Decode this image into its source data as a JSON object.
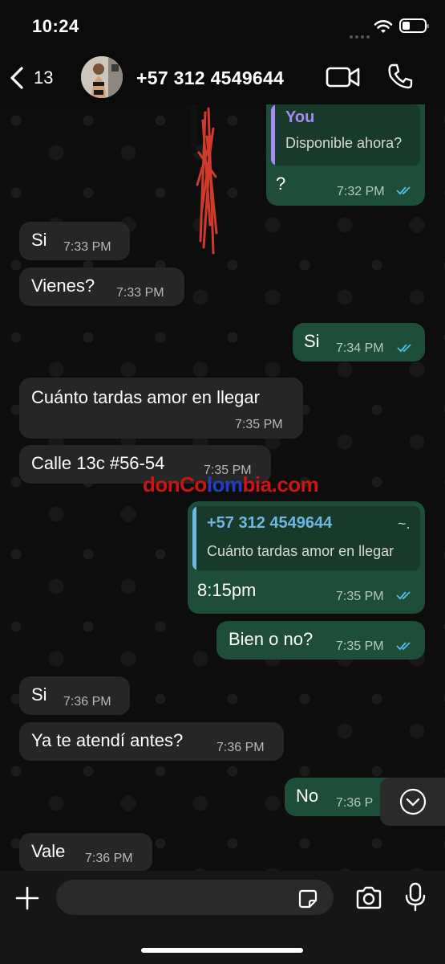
{
  "status_bar": {
    "time": "10:24"
  },
  "header": {
    "back_count": "13",
    "contact_name": "+57 312 4549644"
  },
  "messages": [
    {
      "quote_author": "You",
      "quote_text": "Disponible ahora?",
      "text": "?",
      "time": "7:32 PM",
      "direction": "out"
    },
    {
      "text": "Si",
      "time": "7:33 PM",
      "direction": "in"
    },
    {
      "text": "Vienes?",
      "time": "7:33 PM",
      "direction": "in"
    },
    {
      "text": "Si",
      "time": "7:34 PM",
      "direction": "out"
    },
    {
      "text": "Cuánto tardas amor en llegar",
      "time": "7:35 PM",
      "direction": "in"
    },
    {
      "text": "Calle 13c #56-54",
      "time": "7:35 PM",
      "direction": "in"
    },
    {
      "quote_author": "+57 312 4549644",
      "quote_tilde": "~.",
      "quote_text": "Cuánto tardas amor en llegar",
      "text": "8:15pm",
      "time": "7:35 PM",
      "direction": "out"
    },
    {
      "text": "Bien o no?",
      "time": "7:35 PM",
      "direction": "out"
    },
    {
      "text": "Si",
      "time": "7:36 PM",
      "direction": "in"
    },
    {
      "text": "Ya te atendí antes?",
      "time": "7:36 PM",
      "direction": "in"
    },
    {
      "text": "No",
      "time": "7:36 P",
      "direction": "out"
    },
    {
      "text": "Vale",
      "time": "7:36 PM",
      "direction": "in"
    }
  ],
  "watermark": {
    "part1": "donCo",
    "part2": "lom",
    "part3": "bia.com"
  },
  "input": {
    "placeholder": ""
  },
  "colors": {
    "incoming_bubble": "#262626",
    "outgoing_bubble": "#1e4d39",
    "read_ticks": "#53bdeb",
    "you_quote": "#a48cf2",
    "phone_quote": "#6fb6e5"
  },
  "icons": [
    "back-chevron-icon",
    "video-call-icon",
    "phone-call-icon",
    "chevron-down-icon",
    "plus-icon",
    "sticker-icon",
    "camera-icon",
    "microphone-icon"
  ]
}
